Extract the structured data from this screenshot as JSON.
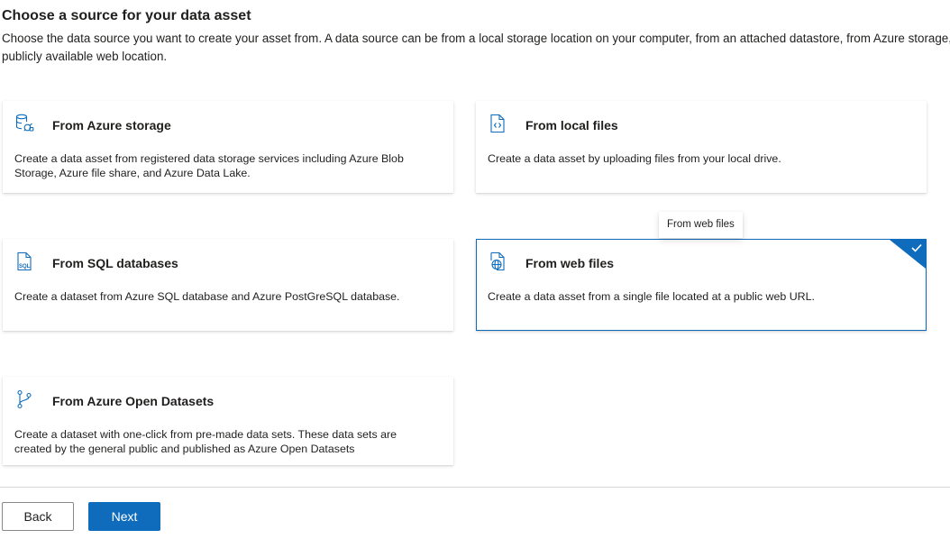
{
  "header": {
    "title": "Choose a source for your data asset",
    "description": "Choose the data source you want to create your asset from. A data source can be from a local storage location on your computer, from an attached datastore, from Azure storage, or from a publicly available web location."
  },
  "cards": [
    {
      "id": "azure-storage",
      "icon": "storage-icon",
      "title": "From Azure storage",
      "body": "Create a data asset from registered data storage services including Azure Blob Storage, Azure file share, and Azure Data Lake.",
      "selected": false
    },
    {
      "id": "local-files",
      "icon": "code-file-icon",
      "title": "From local files",
      "body": "Create a data asset by uploading files from your local drive.",
      "selected": false
    },
    {
      "id": "sql-databases",
      "icon": "sql-file-icon",
      "title": "From SQL databases",
      "body": "Create a dataset from Azure SQL database and Azure PostGreSQL database.",
      "selected": false
    },
    {
      "id": "web-files",
      "icon": "web-file-icon",
      "title": "From web files",
      "body": "Create a data asset from a single file located at a public web URL.",
      "selected": true
    },
    {
      "id": "open-datasets",
      "icon": "branch-icon",
      "title": "From Azure Open Datasets",
      "body": "Create a dataset with one-click from pre-made data sets. These data sets are created by the general public and published as Azure Open Datasets",
      "selected": false
    }
  ],
  "icon_labels": {
    "sql": "SQL"
  },
  "tooltip": {
    "text": "From web files"
  },
  "footer": {
    "back_label": "Back",
    "next_label": "Next"
  },
  "colors": {
    "accent": "#0f6cbd",
    "text": "#201f1e",
    "border": "#8a8886"
  }
}
